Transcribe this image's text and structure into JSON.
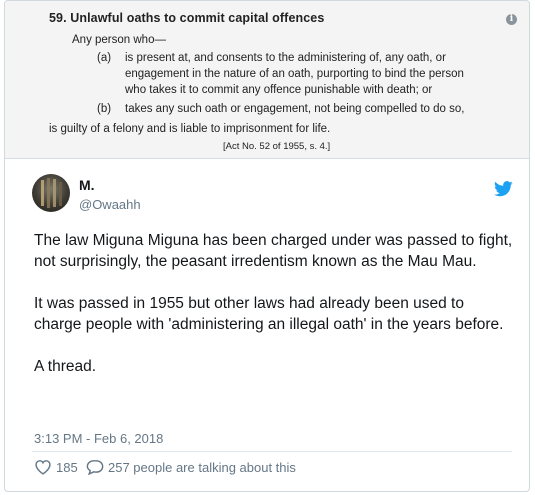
{
  "media": {
    "section_title": "59.  Unlawful oaths to commit capital offences",
    "intro": "Any person who—",
    "item_a_marker": "(a)",
    "item_a_lines": [
      "is present at, and consents to the administering of, any oath, or",
      "engagement in the nature of an oath, purporting to bind the person",
      "who takes it to commit any offence punishable with death; or"
    ],
    "item_b_marker": "(b)",
    "item_b_text": "takes any such oath or engagement, not being compelled to do so,",
    "conclusion": "is guilty of a felony and is liable to imprisonment for life.",
    "citation": "[Act No. 52 of 1955, s. 4.]",
    "info_glyph": "i"
  },
  "tweet": {
    "author_name": "M.",
    "author_handle": "@Owaahh",
    "paragraphs": [
      "The law Miguna Miguna has been charged under was passed to fight, not surprisingly, the peasant irredentism known as the Mau Mau.",
      "It was passed in 1955 but other laws had already been used to charge people with 'administering an illegal oath' in the years before.",
      "A thread."
    ],
    "timestamp": "3:13 PM - Feb 6, 2018",
    "likes_count": "185",
    "replies_label": "257 people are talking about this"
  },
  "colors": {
    "twitter_blue": "#1da1f2",
    "secondary_text": "#657786",
    "primary_text": "#14171a"
  },
  "icons": [
    "info-icon",
    "twitter-bird-icon",
    "heart-icon",
    "comment-icon"
  ]
}
